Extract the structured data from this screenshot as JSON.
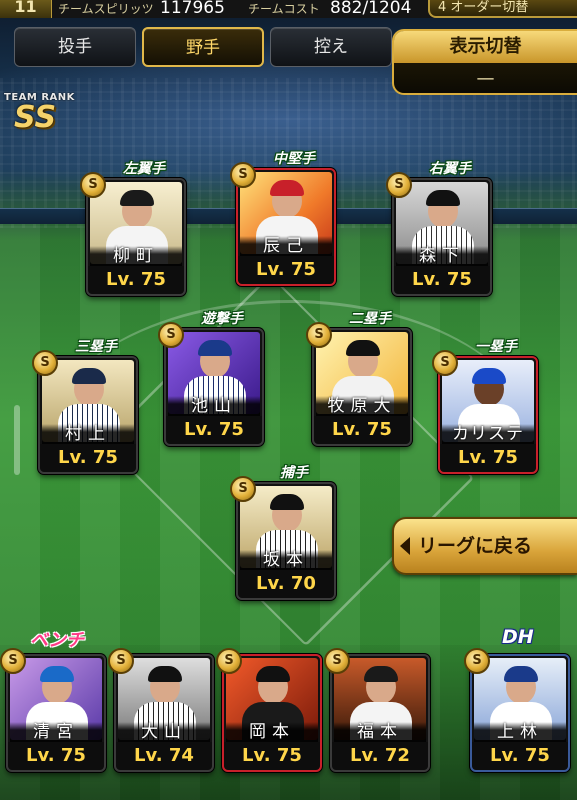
{
  "topbar": {
    "level": "11",
    "spirits_label": "チームスピリッツ",
    "spirits_value": "117965",
    "cost_label": "チームコスト",
    "cost_value": "882/1204",
    "right_text": "4 オーダー切替"
  },
  "tabs": [
    {
      "label": "投手",
      "active": false
    },
    {
      "label": "野手",
      "active": true
    },
    {
      "label": "控え",
      "active": false
    }
  ],
  "display_toggle": {
    "label": "表示切替",
    "value": "—"
  },
  "team_rank": {
    "label": "TEAM RANK",
    "value": "SS"
  },
  "league_button": {
    "label": "リーグに戻る"
  },
  "bench": {
    "label": "ベンチ",
    "dh_label": "DH"
  },
  "players": [
    {
      "id": "lf",
      "position": "左翼手",
      "name": "柳町",
      "level": "Lv. 75",
      "badge": "S"
    },
    {
      "id": "cf",
      "position": "中堅手",
      "name": "辰己",
      "level": "Lv. 75",
      "badge": "S"
    },
    {
      "id": "rf",
      "position": "右翼手",
      "name": "森下",
      "level": "Lv. 75",
      "badge": "S"
    },
    {
      "id": "3b",
      "position": "三塁手",
      "name": "村上",
      "level": "Lv. 75",
      "badge": "S"
    },
    {
      "id": "ss",
      "position": "遊撃手",
      "name": "池山",
      "level": "Lv. 75",
      "badge": "S"
    },
    {
      "id": "2b",
      "position": "二塁手",
      "name": "牧原大",
      "level": "Lv. 75",
      "badge": "S"
    },
    {
      "id": "1b",
      "position": "一塁手",
      "name": "カリステ",
      "level": "Lv. 75",
      "badge": "S"
    },
    {
      "id": "c",
      "position": "捕手",
      "name": "坂本",
      "level": "Lv. 70",
      "badge": "S"
    },
    {
      "id": "b1",
      "position": "",
      "name": "清宮",
      "level": "Lv. 75",
      "badge": "S"
    },
    {
      "id": "b2",
      "position": "",
      "name": "大山",
      "level": "Lv. 74",
      "badge": "S"
    },
    {
      "id": "b3",
      "position": "",
      "name": "岡本",
      "level": "Lv. 75",
      "badge": "S"
    },
    {
      "id": "b4",
      "position": "",
      "name": "福本",
      "level": "Lv. 72",
      "badge": "S"
    },
    {
      "id": "dh",
      "position": "",
      "name": "上林",
      "level": "Lv. 75",
      "badge": "S"
    }
  ]
}
